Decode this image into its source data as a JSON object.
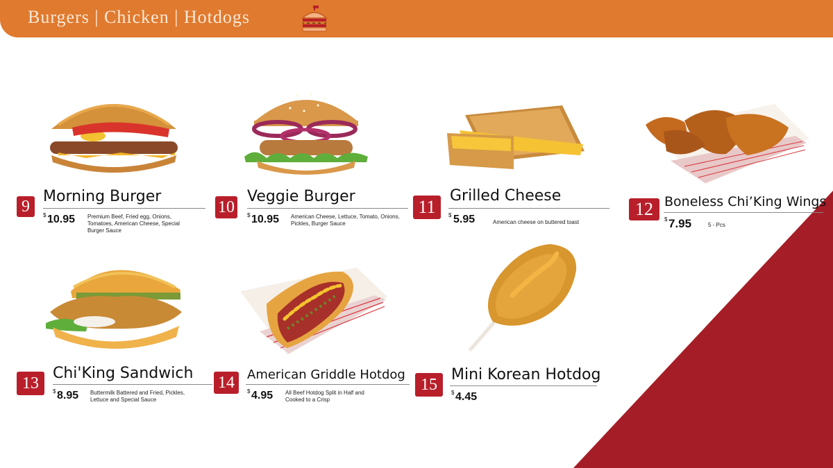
{
  "header": {
    "title": "Burgers | Chicken | Hotdogs",
    "icon": "burger-icon",
    "color": "#e07a2e"
  },
  "accent_color": "#b81f2a",
  "items": [
    {
      "number": "9",
      "name": "Morning Burger",
      "currency": "$",
      "price": "10.95",
      "description": "Premium Beef,  Fried egg, Onions, Tomatoes, American Cheese, Special Burger Sauce",
      "image": "morning-burger-photo"
    },
    {
      "number": "10",
      "name": "Veggie Burger",
      "currency": "$",
      "price": "10.95",
      "description": "American Cheese, Lettuce, Tomato, Onions, Pickles, Burger Sauce",
      "image": "veggie-burger-photo"
    },
    {
      "number": "11",
      "name": "Grilled Cheese",
      "currency": "$",
      "price": "5.95",
      "description": "American cheese on buttered toast",
      "image": "grilled-cheese-photo"
    },
    {
      "number": "12",
      "name": "Boneless Chi’King Wings",
      "currency": "$",
      "price": "7.95",
      "description": "5 - Pcs",
      "image": "boneless-wings-photo"
    },
    {
      "number": "13",
      "name": "Chi'King Sandwich",
      "currency": "$",
      "price": "8.95",
      "description": "Buttermilk Battered and Fried, Pickles, Lettuce and Special Sauce",
      "image": "chicken-sandwich-photo"
    },
    {
      "number": "14",
      "name": "American Griddle Hotdog",
      "currency": "$",
      "price": "4.95",
      "description": "All Beef Hotdog Split in Half and Cooked to a Crisp",
      "image": "american-hotdog-photo"
    },
    {
      "number": "15",
      "name": "Mini Korean Hotdog",
      "currency": "$",
      "price": "4.45",
      "description": "",
      "image": "korean-hotdog-photo"
    }
  ]
}
